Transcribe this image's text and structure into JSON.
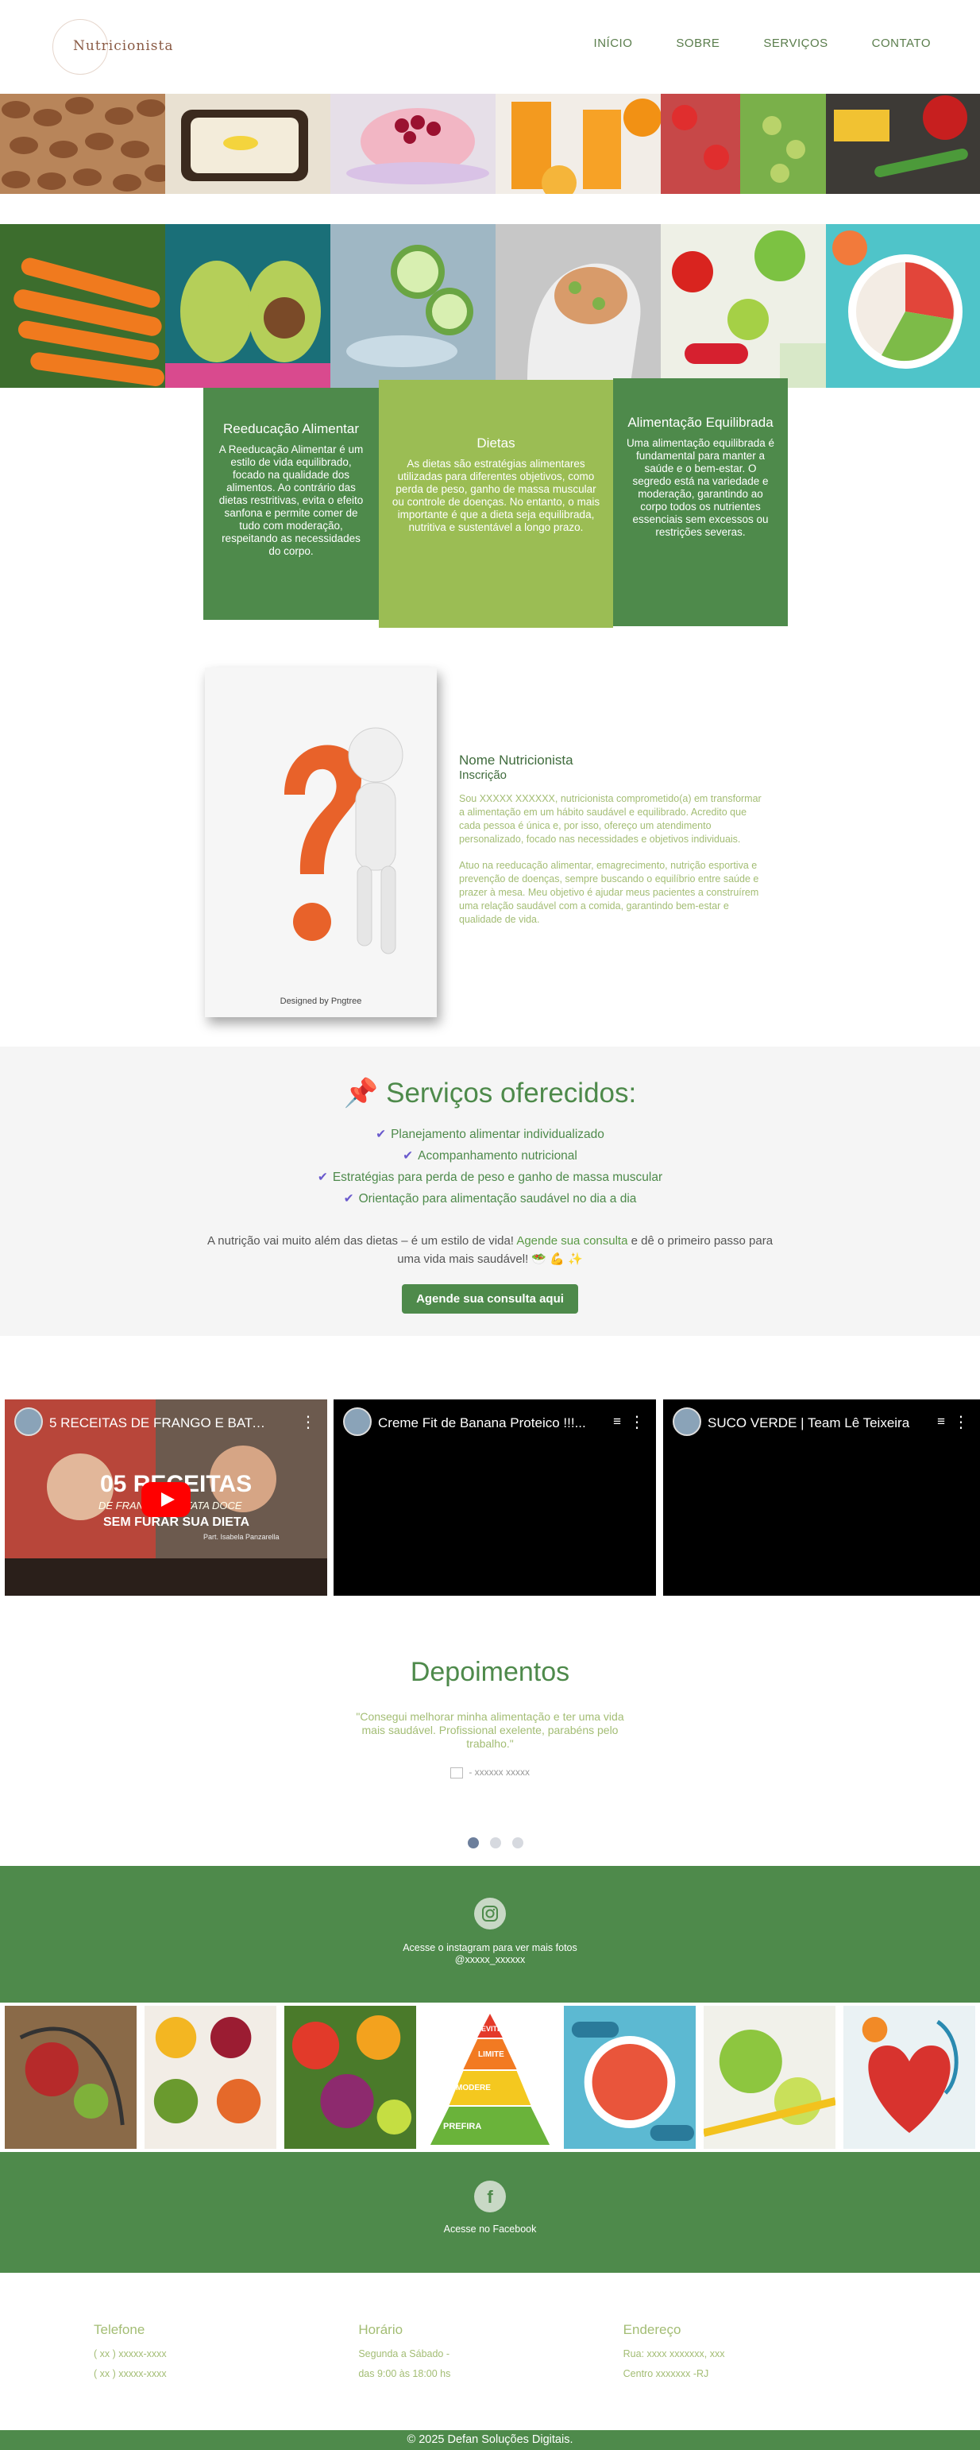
{
  "header": {
    "logo_text": "Nutricionista",
    "nav": [
      "INÍCIO",
      "SOBRE",
      "SERVIÇOS",
      "CONTATO"
    ]
  },
  "gallery_top": [
    "almonds",
    "toast with banana",
    "berries bowl",
    "orange juice",
    "strawberries and grapes",
    "vegetables on board"
  ],
  "gallery_middle": [
    "carrots",
    "avocado",
    "cucumber splash",
    "brain illustration",
    "apples and dumbbell",
    "healthy plate"
  ],
  "cards": [
    {
      "title": "Reeducação Alimentar",
      "text": "A Reeducação Alimentar é um estilo de vida equilibrado, focado na qualidade dos alimentos. Ao contrário das dietas restritivas, evita o efeito sanfona e permite comer de tudo com moderação, respeitando as necessidades do corpo."
    },
    {
      "title": "Dietas",
      "text": "As dietas são estratégias alimentares utilizadas para diferentes objetivos, como perda de peso, ganho de massa muscular ou controle de doenças. No entanto, o mais importante é que a dieta seja equilibrada, nutritiva e sustentável a longo prazo."
    },
    {
      "title": "Alimentação Equilibrada",
      "text": "Uma alimentação equilibrada é fundamental para manter a saúde e o bem-estar. O segredo está na variedade e moderação, garantindo ao corpo todos os nutrientes essenciais sem excessos ou restrições severas."
    }
  ],
  "about": {
    "photo_caption": "Designed by Pngtree",
    "name": "Nome Nutricionista",
    "registration": "Inscrição",
    "paragraphs": [
      "Sou XXXXX XXXXXX, nutricionista comprometido(a) em transformar a alimentação em um hábito saudável e equilibrado. Acredito que cada pessoa é única e, por isso, ofereço um atendimento personalizado, focado nas necessidades e objetivos individuais.",
      "Atuo na reeducação alimentar, emagrecimento, nutrição esportiva e prevenção de doenças, sempre buscando o equilíbrio entre saúde e prazer à mesa. Meu objetivo é ajudar meus pacientes a construírem uma relação saudável com a comida, garantindo bem-estar e qualidade de vida."
    ]
  },
  "services": {
    "pin": "📌",
    "title": "Serviços oferecidos:",
    "check": "✔",
    "items": [
      "Planejamento alimentar individualizado",
      "Acompanhamento nutricional",
      "Estratégias para perda de peso e ganho de massa muscular",
      "Orientação para alimentação saudável no dia a dia"
    ],
    "lead_before": "A nutrição vai muito além das dietas – é um estilo de vida!",
    "lead_link": "Agende sua consulta",
    "lead_after": "e dê o primeiro passo para uma vida mais saudável! 🥗 💪 ✨",
    "cta": "Agende sua consulta aqui"
  },
  "videos": [
    {
      "title": "5 RECEITAS DE FRANGO E BATATA D...",
      "thumb_title": "05 RECEITAS",
      "thumb_sub": "DE FRANGO E BATATA DOCE",
      "thumb_line": "SEM FURAR SUA DIETA",
      "thumb_credit": "Part. Isabela Panzarella"
    },
    {
      "title": "Creme Fit de Banana Proteico !!!..."
    },
    {
      "title": "SUCO VERDE | Team Lê Teixeira"
    }
  ],
  "testimonials": {
    "title": "Depoimentos",
    "quote": "\"Consegui melhorar minha alimentação e ter uma vida mais saudável. Profissional exelente, parabéns pelo trabalho.\"",
    "author": "- xxxxxx xxxxx"
  },
  "instagram": {
    "line1": "Acesse o instagram para ver mais fotos",
    "line2": "@xxxxx_xxxxxx",
    "photos": [
      "stethoscope and vegetables",
      "healthy bowls",
      "fruits and vegetables",
      "food pyramid",
      "fitness plate",
      "apples and tape",
      "heart fruits"
    ],
    "pyramid_labels": [
      "EVITE",
      "LIMITE",
      "MODERE",
      "PREFIRA"
    ]
  },
  "facebook": {
    "text": "Acesse no Facebook"
  },
  "footer": {
    "columns": [
      {
        "title": "Telefone",
        "lines": [
          "( xx ) xxxxx-xxxx",
          "( xx ) xxxxx-xxxx"
        ]
      },
      {
        "title": "Horário",
        "lines": [
          "Segunda a Sábado -",
          "das 9:00 às 18:00 hs"
        ]
      },
      {
        "title": "Endereço",
        "lines": [
          "Rua: xxxx xxxxxxx, xxx",
          "Centro xxxxxxx -RJ"
        ]
      }
    ],
    "copyright": "© 2025 Defan Soluções Digitais."
  },
  "colors": {
    "primary_green": "#4e8a4b",
    "light_green": "#9bbd54",
    "text_green": "#a3bd74",
    "brand_brown": "#8a5a44"
  }
}
